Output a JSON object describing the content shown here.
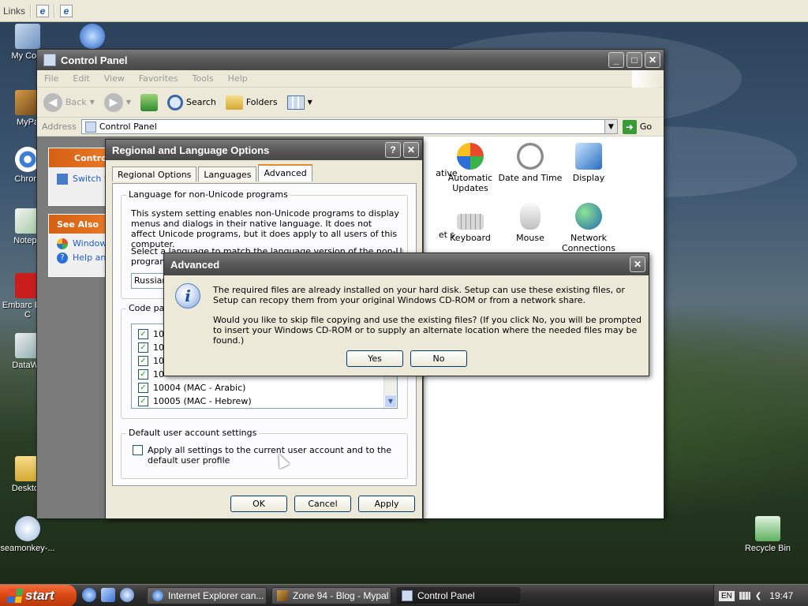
{
  "links_bar": {
    "label": "Links"
  },
  "desktop_icons": [
    {
      "label": "My Com"
    },
    {
      "label": ""
    },
    {
      "label": "MyPa"
    },
    {
      "label": "Chrom"
    },
    {
      "label": "Notepa"
    },
    {
      "label": "Embarc Dev-C"
    },
    {
      "label": "DataWa"
    },
    {
      "label": "Desktop"
    },
    {
      "label": "seamonkey-..."
    },
    {
      "label": "Recycle Bin"
    }
  ],
  "control_panel": {
    "title": "Control Panel",
    "menu": [
      "File",
      "Edit",
      "View",
      "Favorites",
      "Tools",
      "Help"
    ],
    "toolbar": {
      "back": "Back",
      "search": "Search",
      "folders": "Folders"
    },
    "address_label": "Address",
    "address_value": "Control Panel",
    "go_label": "Go",
    "side_task_title": "Contro",
    "side_task_link": "Switch t",
    "see_also_title": "See Also",
    "see_also_links": [
      "Window",
      "Help an"
    ],
    "items": [
      {
        "label": "ative"
      },
      {
        "label": "Automatic Updates"
      },
      {
        "label": "Date and Time"
      },
      {
        "label": "Display"
      },
      {
        "label": "et s"
      },
      {
        "label": "Keyboard"
      },
      {
        "label": "Mouse"
      },
      {
        "label": "Network Connections"
      }
    ]
  },
  "regional_dialog": {
    "title": "Regional and Language Options",
    "help_btn": "?",
    "close_btn": "✕",
    "tabs": [
      "Regional Options",
      "Languages",
      "Advanced"
    ],
    "nonunicode_legend": "Language for non-Unicode programs",
    "nonunicode_text": "This system setting enables non-Unicode programs to display menus and dialogs in their native language. It does not affect Unicode programs, but it does apply to all users of this computer.",
    "select_text_1": "Select a language to match the language version of the non-Unicode",
    "select_text_2": "program",
    "selected_language": "Russian",
    "codepage_legend": "Code pag",
    "codepages": [
      {
        "label": "10",
        "checked": true
      },
      {
        "label": "10",
        "checked": true
      },
      {
        "label": "10",
        "checked": true
      },
      {
        "label": "10",
        "checked": true
      },
      {
        "label": "10004  (MAC - Arabic)",
        "checked": true
      },
      {
        "label": "10005  (MAC - Hebrew)",
        "checked": true
      }
    ],
    "default_legend": "Default user account settings",
    "apply_all_text": "Apply all settings to the current user account and to the default user profile",
    "ok": "OK",
    "cancel": "Cancel",
    "apply": "Apply"
  },
  "advanced_dialog": {
    "title": "Advanced",
    "close_btn": "✕",
    "message_1": "The required files are already installed on your hard disk. Setup can use these existing files, or Setup can recopy them from your original Windows CD-ROM or from a network share.",
    "message_2": "Would you like to skip file copying and use the existing files? (If you click No, you will be prompted to insert your Windows CD-ROM or to supply an alternate location where the needed files may be found.)",
    "yes": "Yes",
    "no": "No"
  },
  "taskbar": {
    "start": "start",
    "tasks": [
      "Internet Explorer can...",
      "Zone 94 - Blog - Mypal",
      "Control Panel"
    ],
    "lang": "EN",
    "clock": "19:47"
  }
}
